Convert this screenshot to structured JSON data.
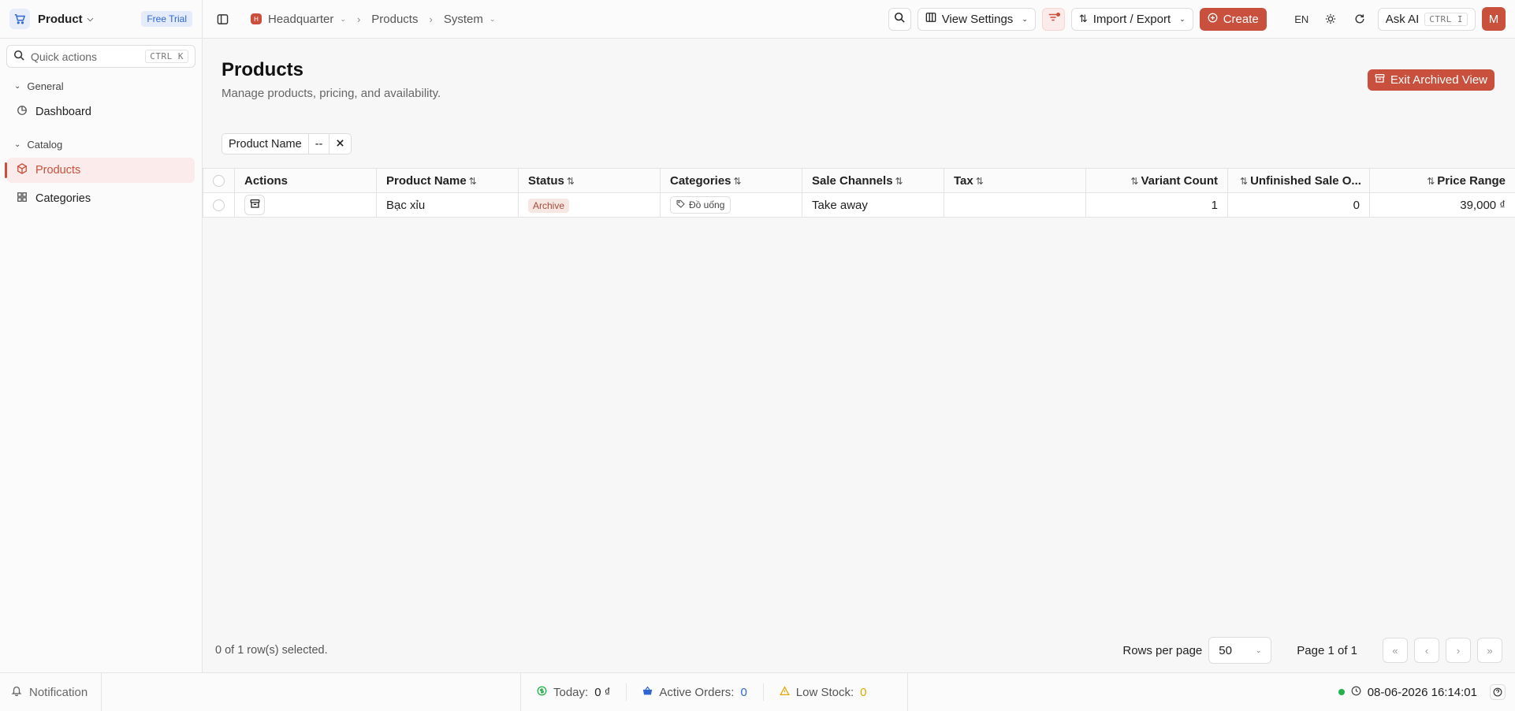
{
  "app": {
    "name": "Product",
    "trial_badge": "Free Trial"
  },
  "quick_actions": {
    "label": "Quick actions",
    "shortcut": "CTRL K"
  },
  "sidebar": {
    "groups": [
      {
        "label": "General",
        "items": [
          {
            "label": "Dashboard",
            "icon": "dashboard-icon",
            "active": false
          }
        ]
      },
      {
        "label": "Catalog",
        "items": [
          {
            "label": "Products",
            "icon": "box-icon",
            "active": true
          },
          {
            "label": "Categories",
            "icon": "grid-icon",
            "active": false
          }
        ]
      }
    ]
  },
  "breadcrumb": {
    "org": "Headquarter",
    "org_initial": "H",
    "section": "Products",
    "sub": "System"
  },
  "toolbar": {
    "view_settings": "View Settings",
    "import_export": "Import / Export",
    "create": "Create",
    "lang": "EN",
    "ask_ai": "Ask AI",
    "ask_ai_shortcut": "CTRL I",
    "avatar": "M"
  },
  "page": {
    "title": "Products",
    "subtitle": "Manage products, pricing, and availability.",
    "exit_archived": "Exit Archived View"
  },
  "filter": {
    "field": "Product Name",
    "operator": "--"
  },
  "table": {
    "columns": [
      "Actions",
      "Product Name",
      "Status",
      "Categories",
      "Sale Channels",
      "Tax",
      "Variant Count",
      "Unfinished Sale O...",
      "Price Range"
    ],
    "rows": [
      {
        "product_name": "Bạc xỉu",
        "status": "Archive",
        "category": "Đồ uống",
        "sale_channels": "Take away",
        "tax": "",
        "variant_count": "1",
        "unfinished_sale_orders": "0",
        "price_range": "39,000 ₫"
      }
    ]
  },
  "footer": {
    "selection": "0 of 1 row(s) selected.",
    "rows_per_page_label": "Rows per page",
    "rows_per_page": "50",
    "page_info": "Page 1 of 1"
  },
  "statusbar": {
    "notification": "Notification",
    "today_label": "Today:",
    "today_value": "0 ₫",
    "active_orders_label": "Active Orders:",
    "active_orders_value": "0",
    "low_stock_label": "Low Stock:",
    "low_stock_value": "0",
    "datetime": "08-06-2026 16:14:01"
  },
  "colors": {
    "accent": "#c8503c",
    "trial": "#2f66d4",
    "online": "#22b14c",
    "low_stock": "#e0a800",
    "orders": "#2f66d4"
  }
}
